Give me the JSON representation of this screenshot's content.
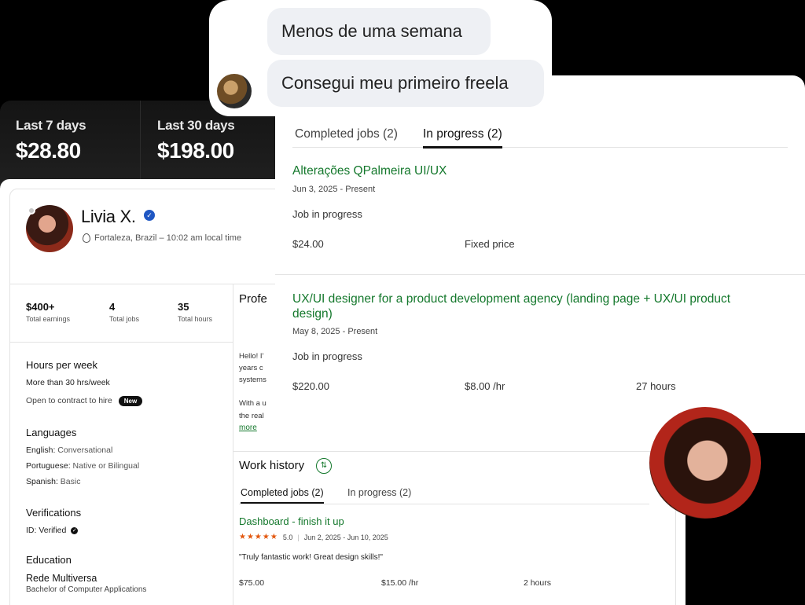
{
  "earnings": {
    "last7": {
      "label": "Last 7 days",
      "value": "$28.80"
    },
    "last30": {
      "label": "Last 30 days",
      "value": "$198.00"
    }
  },
  "chat": {
    "messages": [
      "Menos de uma semana",
      "Consegui meu primeiro freela"
    ]
  },
  "profile": {
    "name": "Livia X.",
    "location": "Fortaleza, Brazil – 10:02 am local time",
    "stats": [
      {
        "value": "$400+",
        "label": "Total earnings"
      },
      {
        "value": "4",
        "label": "Total jobs"
      },
      {
        "value": "35",
        "label": "Total hours"
      }
    ],
    "hours_per_week": {
      "title": "Hours per week",
      "value": "More than 30 hrs/week",
      "contract": "Open to contract to hire",
      "badge": "New"
    },
    "languages": {
      "title": "Languages",
      "items": [
        {
          "lang": "English:",
          "level": "Conversational"
        },
        {
          "lang": "Portuguese:",
          "level": "Native or Bilingual"
        },
        {
          "lang": "Spanish:",
          "level": "Basic"
        }
      ]
    },
    "verifications": {
      "title": "Verifications",
      "id": "ID: Verified"
    },
    "education": {
      "title": "Education",
      "school": "Rede Multiversa",
      "degree": "Bachelor of Computer Applications"
    },
    "professional_title": "Profe",
    "about_lines": [
      "Hello! I'",
      "years c",
      "systems",
      "With a u",
      "the real"
    ],
    "more": "more",
    "work_history": {
      "title": "Work history",
      "tabs": [
        "Completed jobs (2)",
        "In progress (2)"
      ],
      "job": {
        "title": "Dashboard - finish it up",
        "rating": "5.0",
        "dates": "Jun 2, 2025 - Jun 10, 2025",
        "quote": "\"Truly fantastic work! Great design skills!\"",
        "earned": "$75.00",
        "rate": "$15.00 /hr",
        "hours": "2 hours"
      }
    }
  },
  "jobs_panel": {
    "tabs": [
      "Completed jobs (2)",
      "In progress (2)"
    ],
    "jobs": [
      {
        "title": "Alterações QPalmeira UI/UX",
        "dates": "Jun 3, 2025 - Present",
        "status": "Job in progress",
        "amount": "$24.00",
        "type": "Fixed price"
      },
      {
        "title": "UX/UI designer for a product development agency (landing page + UX/UI product design)",
        "dates": "May 8, 2025 - Present",
        "status": "Job in progress",
        "amount": "$220.00",
        "rate": "$8.00 /hr",
        "hours": "27 hours"
      }
    ]
  },
  "colors": {
    "accent_green": "#14782c",
    "star_orange": "#e3580f",
    "verified_blue": "#1f57c3"
  }
}
